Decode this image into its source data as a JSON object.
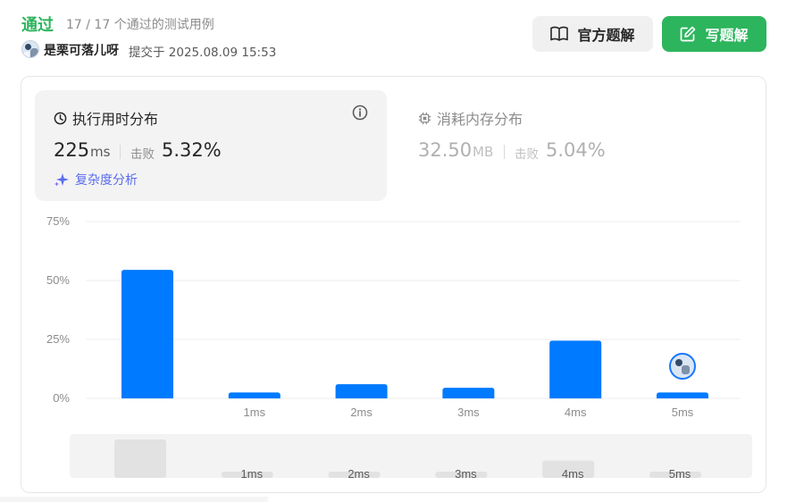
{
  "result": {
    "status": "通过",
    "detail": "17 / 17 个通过的测试用例"
  },
  "submission": {
    "username": "是栗可落儿呀",
    "submitted_text": "提交于 2025.08.09 15:53"
  },
  "buttons": {
    "official": "官方题解",
    "write": "写题解"
  },
  "runtime": {
    "title": "执行用时分布",
    "value": "225",
    "unit": "ms",
    "beat_label": "击败",
    "beat_value": "5.32%",
    "complexity_label": "复杂度分析"
  },
  "memory": {
    "title": "消耗内存分布",
    "value": "32.50",
    "unit": "MB",
    "beat_label": "击败",
    "beat_value": "5.04%"
  },
  "colors": {
    "accent_green": "#2db55d",
    "bar_blue": "#007aff",
    "complexity_purple": "#5a6cf0"
  },
  "chart_data": {
    "type": "bar",
    "categories": [
      "",
      "1ms",
      "2ms",
      "3ms",
      "4ms",
      "5ms"
    ],
    "values": [
      54.5,
      2.5,
      6.0,
      4.5,
      24.5,
      2.5
    ],
    "yticks": [
      "0%",
      "25%",
      "50%",
      "75%"
    ],
    "ylim": [
      0,
      75
    ],
    "overview_values": [
      54.5,
      2.5,
      6.0,
      4.5,
      24.5,
      2.5
    ],
    "user_marker_category": "5ms",
    "grid": true
  }
}
